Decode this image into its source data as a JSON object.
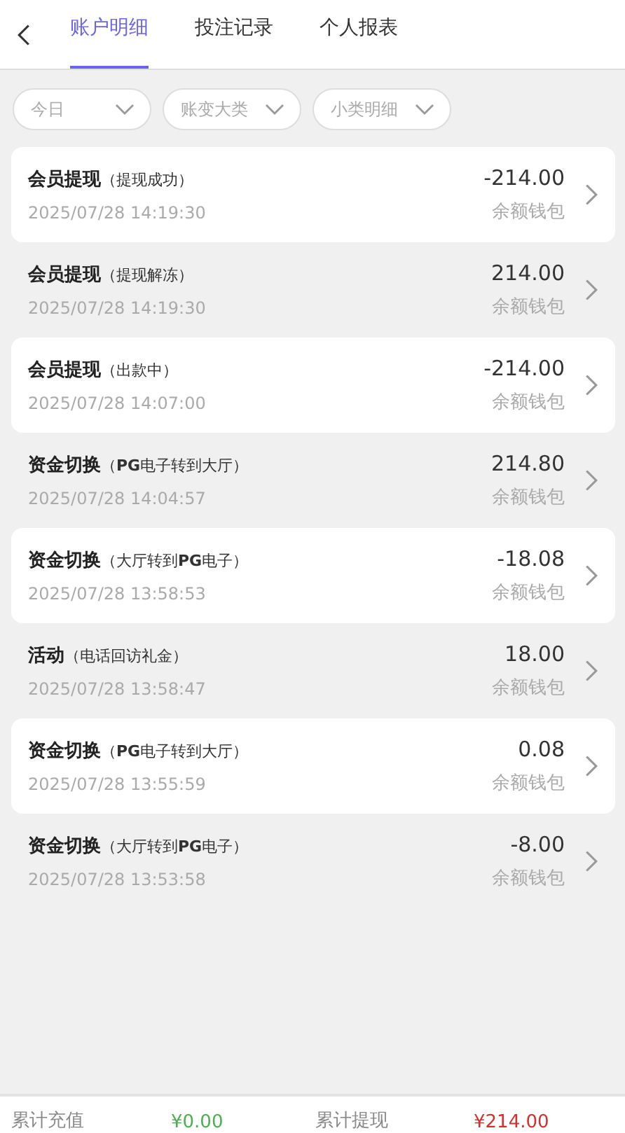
{
  "tabs": [
    {
      "label": "账户明细",
      "selected": true
    },
    {
      "label": "投注记录",
      "selected": false
    },
    {
      "label": "个人报表",
      "selected": false
    }
  ],
  "filters": [
    {
      "label": "今日"
    },
    {
      "label": "账变大类"
    },
    {
      "label": "小类明细"
    }
  ],
  "records": [
    {
      "title": "会员提现",
      "detail": "（提现成功）",
      "time": "2025/07/28 14:19:30",
      "amount": "-214.00",
      "wallet": "余额钱包"
    },
    {
      "title": "会员提现",
      "detail": "（提现解冻）",
      "time": "2025/07/28 14:19:30",
      "amount": "214.00",
      "wallet": "余额钱包"
    },
    {
      "title": "会员提现",
      "detail": "（出款中）",
      "time": "2025/07/28 14:07:00",
      "amount": "-214.00",
      "wallet": "余额钱包"
    },
    {
      "title": "资金切换",
      "detail": "（**PG**电子转到大厅）",
      "time": "2025/07/28 14:04:57",
      "amount": "214.80",
      "wallet": "余额钱包"
    },
    {
      "title": "资金切换",
      "detail": "（大厅转到**PG**电子）",
      "time": "2025/07/28 13:58:53",
      "amount": "-18.08",
      "wallet": "余额钱包"
    },
    {
      "title": "活动",
      "detail": "（电话回访礼金）",
      "time": "2025/07/28 13:58:47",
      "amount": "18.00",
      "wallet": "余额钱包"
    },
    {
      "title": "资金切换",
      "detail": "（**PG**电子转到大厅）",
      "time": "2025/07/28 13:55:59",
      "amount": "0.08",
      "wallet": "余额钱包"
    },
    {
      "title": "资金切换",
      "detail": "（大厅转到**PG**电子）",
      "time": "2025/07/28 13:53:58",
      "amount": "-8.00",
      "wallet": "余额钱包"
    }
  ],
  "footer": {
    "recharge_label": "累计充值",
    "recharge_value": "¥0.00",
    "withdraw_label": "累计提现",
    "withdraw_value": "¥214.00"
  }
}
